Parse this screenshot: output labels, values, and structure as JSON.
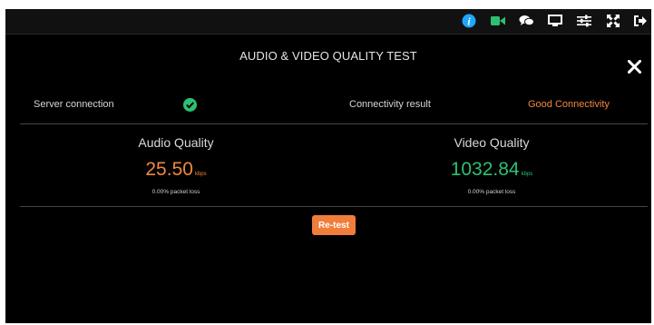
{
  "toolbar": {
    "icons": [
      "info-icon",
      "video-camera-icon",
      "chat-icon",
      "monitor-icon",
      "sliders-icon",
      "fullscreen-icon",
      "exit-icon"
    ],
    "info_color": "#1ea7ff",
    "camera_color": "#2fbf71"
  },
  "dialog": {
    "title": "AUDIO & VIDEO QUALITY TEST",
    "server_connection_label": "Server connection",
    "connectivity_result_label": "Connectivity result",
    "connectivity_result_value": "Good Connectivity",
    "audio": {
      "title": "Audio Quality",
      "value": "25.50",
      "unit": "kbps",
      "packet_loss": "0.00% packet loss"
    },
    "video": {
      "title": "Video Quality",
      "value": "1032.84",
      "unit": "kbps",
      "packet_loss": "0.00% packet loss"
    },
    "retest_label": "Re-test"
  },
  "colors": {
    "accent_orange": "#f0883e",
    "accent_green": "#2fbf71",
    "background": "#000000"
  }
}
